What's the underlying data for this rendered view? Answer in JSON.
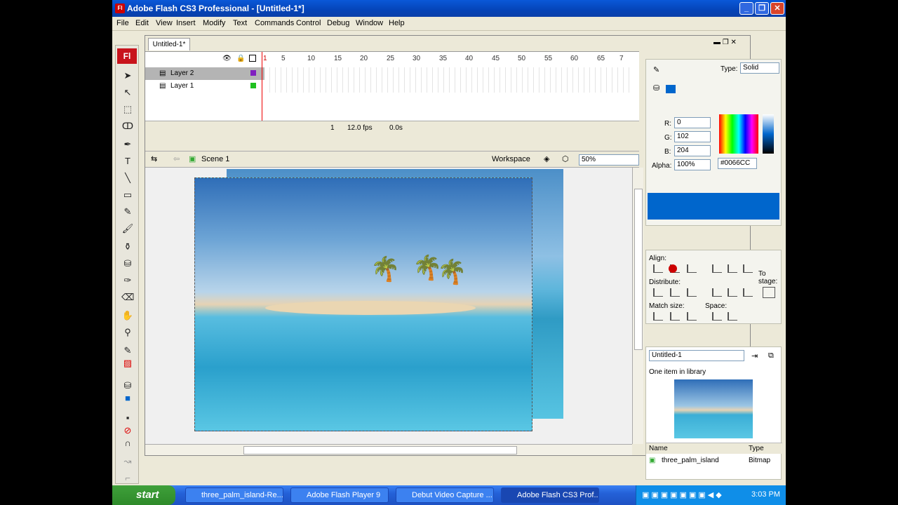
{
  "window": {
    "title": "Adobe Flash CS3 Professional - [Untitled-1*]",
    "logo": "Fl"
  },
  "menu": [
    "File",
    "Edit",
    "View",
    "Insert",
    "Modify",
    "Text",
    "Commands",
    "Control",
    "Debug",
    "Window",
    "Help"
  ],
  "document": {
    "tab": "Untitled-1*"
  },
  "timeline": {
    "layers": [
      "Layer 2",
      "Layer 1"
    ],
    "ruler": [
      "1",
      "5",
      "10",
      "15",
      "20",
      "25",
      "30",
      "35",
      "40",
      "45",
      "50",
      "55",
      "60",
      "65",
      "7"
    ],
    "current_frame": "1",
    "fps": "12.0 fps",
    "time": "0.0s"
  },
  "stage": {
    "scene": "Scene 1",
    "workspace": "Workspace",
    "zoom": "50%"
  },
  "color": {
    "type_label": "Type:",
    "type_value": "Solid",
    "r": "0",
    "g": "102",
    "b": "204",
    "alpha_label": "Alpha:",
    "alpha": "100%",
    "hex": "#0066CC",
    "swatch": "#0066CC",
    "r_label": "R:",
    "g_label": "G:",
    "b_label": "B:"
  },
  "align": {
    "align": "Align:",
    "distribute": "Distribute:",
    "match": "Match size:",
    "space": "Space:",
    "to_stage": "To stage:"
  },
  "library": {
    "document": "Untitled-1",
    "count": "One item in library",
    "col_name": "Name",
    "col_type": "Type",
    "item_name": "three_palm_island",
    "item_type": "Bitmap"
  },
  "taskbar": {
    "start": "start",
    "items": [
      "three_palm_island-Re...",
      "Adobe Flash Player 9",
      "Debut Video Capture ...",
      "Adobe Flash CS3 Prof..."
    ],
    "clock": "3:03 PM"
  }
}
